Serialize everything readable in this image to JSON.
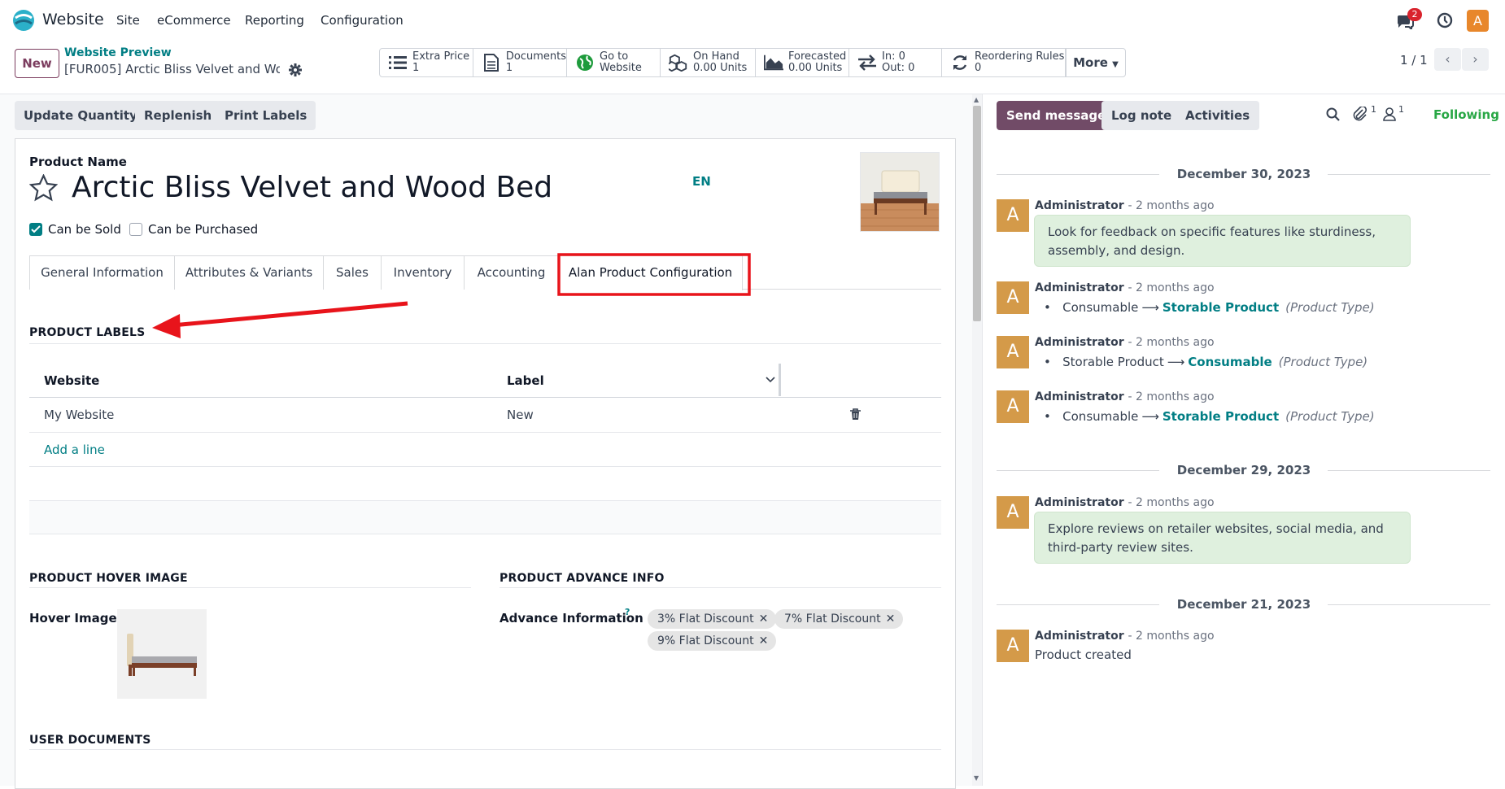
{
  "topnav": {
    "app_name": "Website",
    "menus": [
      "Site",
      "eCommerce",
      "Reporting",
      "Configuration"
    ],
    "msg_badge": "2",
    "avatar": "A"
  },
  "control": {
    "new_label": "New",
    "breadcrumb": "Website Preview",
    "record": "[FUR005] Arctic Bliss Velvet and Wo…",
    "more_label": "More",
    "pager": "1 / 1",
    "smart_buttons": [
      {
        "icon": "list-icon",
        "line1": "Extra Price",
        "line2": "1"
      },
      {
        "icon": "document-icon",
        "line1": "Documents",
        "line2": "1"
      },
      {
        "icon": "globe-icon",
        "line1": "Go to",
        "line2": "Website"
      },
      {
        "icon": "cubes-icon",
        "line1": "On Hand",
        "line2": "0.00 Units"
      },
      {
        "icon": "area-chart-icon",
        "line1": "Forecasted",
        "line2": "0.00 Units"
      },
      {
        "icon": "exchange-icon",
        "line1": "In: 0",
        "line2": "Out: 0"
      },
      {
        "icon": "refresh-icon",
        "line1": "Reordering Rules",
        "line2": "0"
      }
    ]
  },
  "actions": [
    "Update Quantity",
    "Replenish",
    "Print Labels"
  ],
  "form": {
    "product_name_label": "Product Name",
    "product_name": "Arctic Bliss Velvet and Wood Bed",
    "lang": "EN",
    "can_be_sold": "Can be Sold",
    "can_be_purchased": "Can be Purchased",
    "tabs": [
      "General Information",
      "Attributes & Variants",
      "Sales",
      "Inventory",
      "Accounting",
      "Alan Product Configuration"
    ],
    "labels_section": "PRODUCT LABELS",
    "col_website": "Website",
    "col_label": "Label",
    "rows": [
      {
        "website": "My Website",
        "label": "New"
      }
    ],
    "add_line": "Add a line",
    "hover_section": "PRODUCT HOVER IMAGE",
    "hover_label": "Hover Image",
    "advance_section": "PRODUCT ADVANCE INFO",
    "advance_label": "Advance Information",
    "help_mark": "?",
    "tags": [
      "3% Flat Discount",
      "7% Flat Discount",
      "9% Flat Discount"
    ],
    "docs_section": "USER DOCUMENTS"
  },
  "chatter": {
    "send": "Send message",
    "log": "Log note",
    "activities": "Activities",
    "attach_count": "1",
    "follower_count": "1",
    "following": "Following",
    "dates": [
      "December 30, 2023",
      "December 29, 2023",
      "December 21, 2023"
    ],
    "messages": [
      {
        "author": "Administrator",
        "time": "- 2 months ago",
        "body": "Look for feedback on specific features like sturdiness, assembly, and design."
      },
      {
        "author": "Administrator",
        "time": "- 2 months ago",
        "old": "Consumable",
        "new": "Storable Product",
        "field": "(Product Type)"
      },
      {
        "author": "Administrator",
        "time": "- 2 months ago",
        "old": "Storable Product",
        "new": "Consumable",
        "field": "(Product Type)"
      },
      {
        "author": "Administrator",
        "time": "- 2 months ago",
        "old": "Consumable",
        "new": "Storable Product",
        "field": "(Product Type)"
      },
      {
        "author": "Administrator",
        "time": "- 2 months ago",
        "body": "Explore reviews on retailer websites, social media, and third-party review sites."
      },
      {
        "author": "Administrator",
        "time": "- 2 months ago",
        "body": "Product created"
      }
    ],
    "avatar": "A"
  },
  "colors": {
    "primary": "#714B67",
    "teal": "#017E84",
    "annotation": "#E8141B",
    "following": "#28A745",
    "note_bg": "#DFF0DE"
  }
}
